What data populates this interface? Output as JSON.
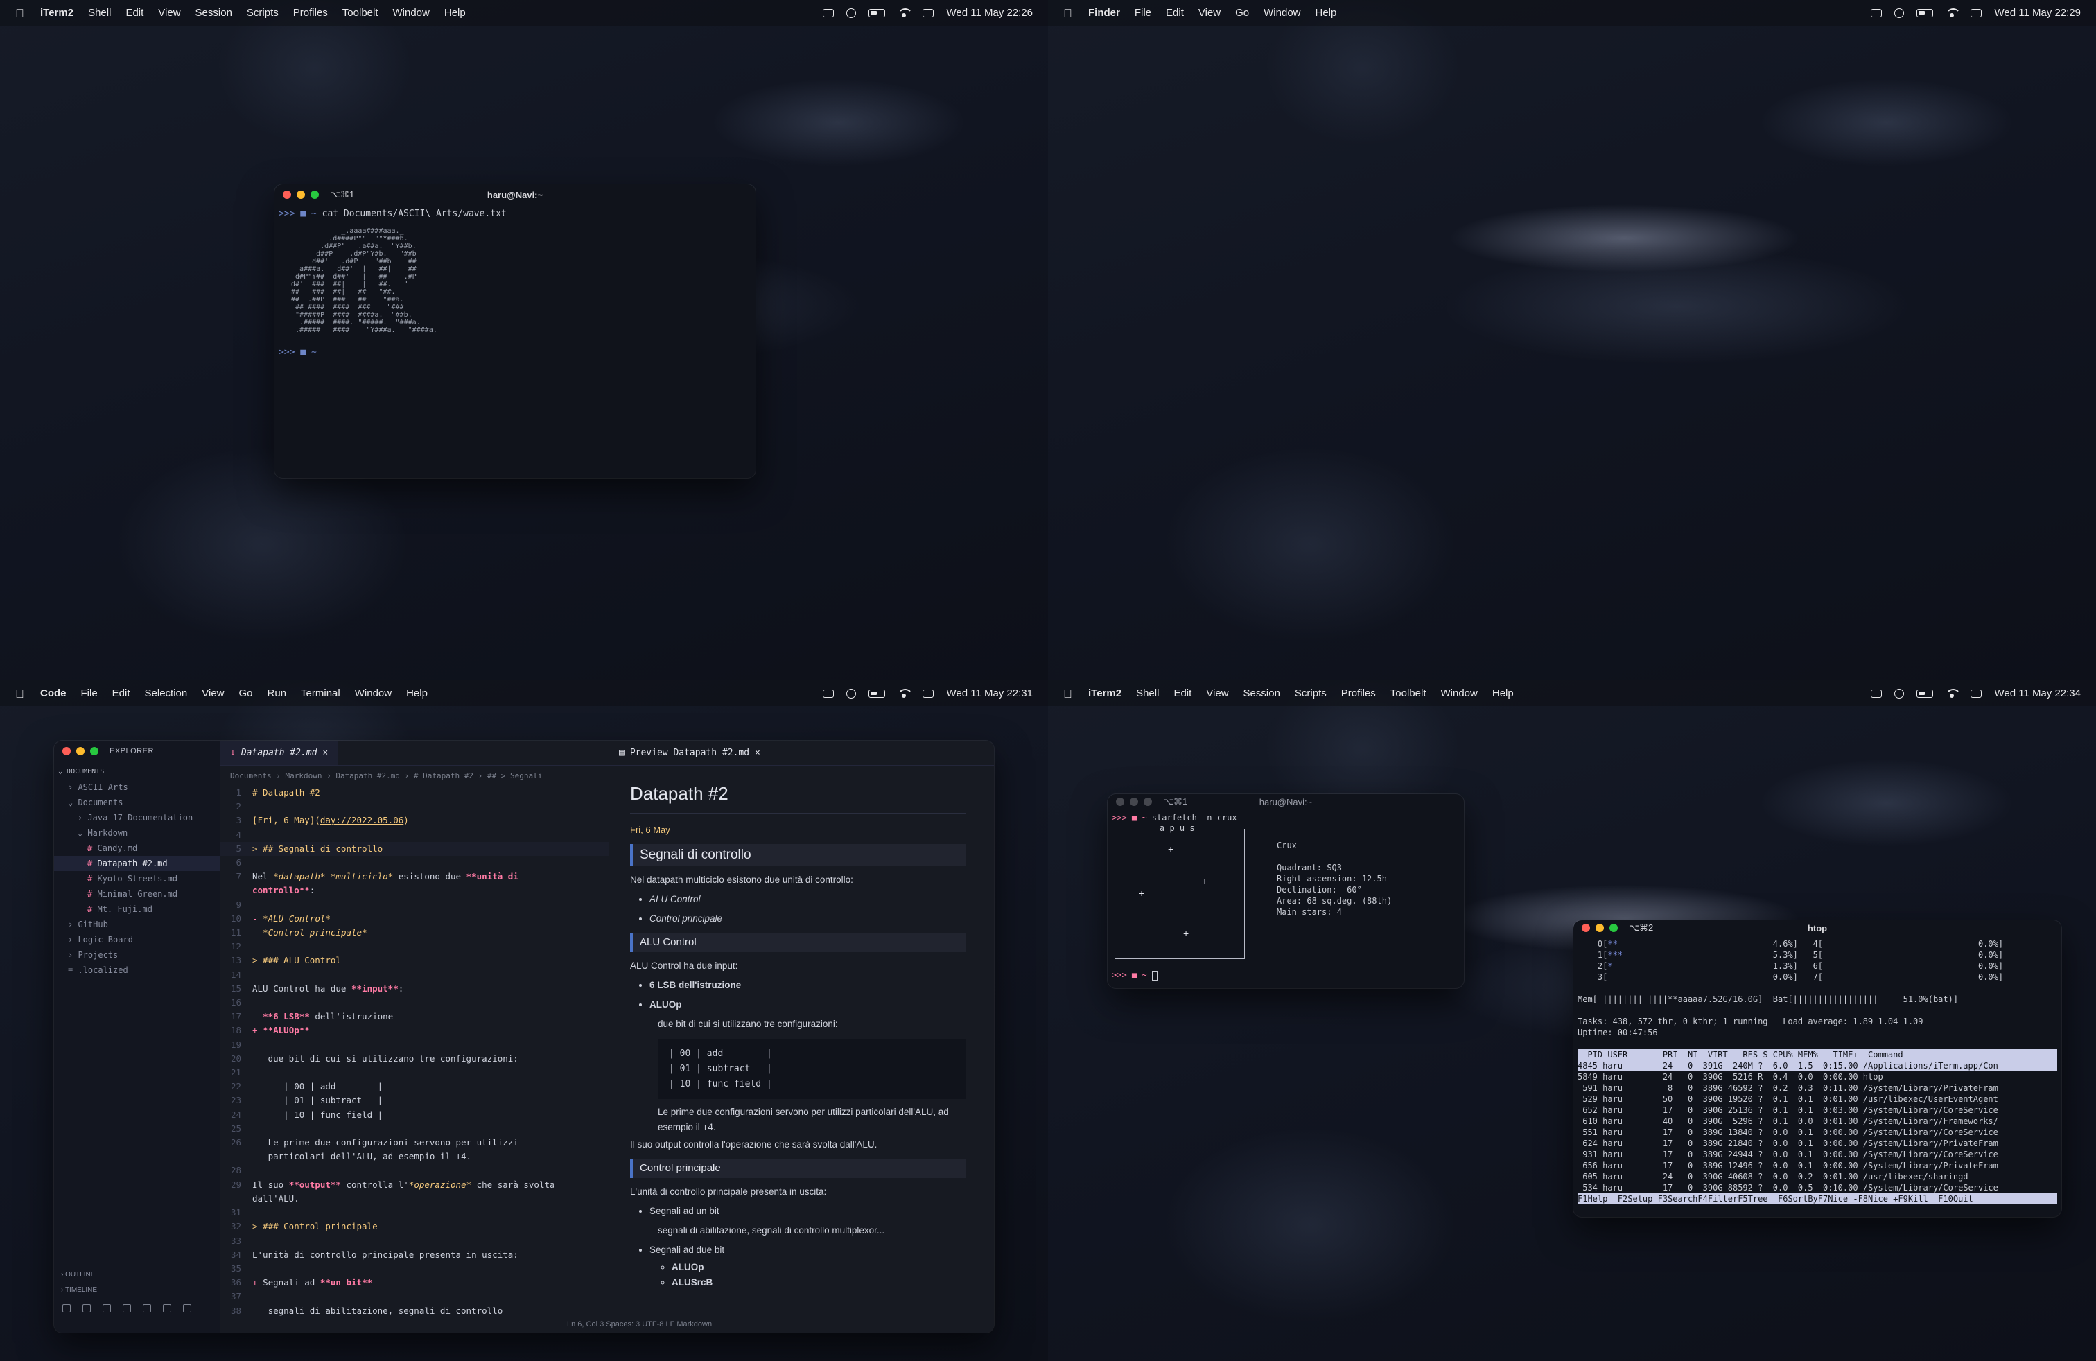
{
  "q1": {
    "menubar": {
      "app": "iTerm2",
      "items": [
        "Shell",
        "Edit",
        "View",
        "Session",
        "Scripts",
        "Profiles",
        "Toolbelt",
        "Window",
        "Help"
      ],
      "clock": "Wed 11 May  22:26"
    },
    "window": {
      "shortcut": "⌥⌘1",
      "title": "haru@Navi:~",
      "command": "cat Documents/ASCII\\ Arts/wave.txt"
    }
  },
  "q2": {
    "menubar": {
      "app": "Finder",
      "items": [
        "File",
        "Edit",
        "View",
        "Go",
        "Window",
        "Help"
      ],
      "clock": "Wed 11 May  22:29"
    }
  },
  "q3": {
    "menubar": {
      "app": "Code",
      "items": [
        "File",
        "Edit",
        "Selection",
        "View",
        "Go",
        "Run",
        "Terminal",
        "Window",
        "Help"
      ],
      "clock": "Wed 11 May  22:31"
    },
    "explorer": {
      "title": "EXPLORER",
      "tree": [
        "DOCUMENTS",
        "ASCII Arts",
        "Documents",
        "Java 17 Documentation",
        "Markdown",
        "Candy.md",
        "Datapath #2.md",
        "Kyoto Streets.md",
        "Minimal Green.md",
        "Mt. Fuji.md",
        "GitHub",
        "Logic Board",
        "Projects",
        ".localized"
      ],
      "outline": "OUTLINE",
      "timeline": "TIMELINE"
    },
    "editor": {
      "tab": "Datapath #2.md",
      "breadcrumbs": "Documents › Markdown › Datapath #2.md › # Datapath #2 › ## > Segnali",
      "status": "Ln 6, Col 3   Spaces: 3   UTF-8   LF   Markdown"
    },
    "preview": {
      "tab": "Preview Datapath #2.md",
      "h1": "Datapath #2",
      "date": "Fri, 6 May",
      "h2": "Segnali di controllo",
      "intro": "Nel datapath multiciclo esistono due unità di controllo:",
      "units": [
        "ALU Control",
        "Control principale"
      ],
      "h3a": "ALU Control",
      "alu_input": "ALU Control ha due input:",
      "inputs": [
        "6 LSB dell'istruzione",
        "ALUOp"
      ],
      "config_text": "due bit di cui si utilizzano tre configurazioni:",
      "table": "| 00 | add        |\n| 01 | subtract   |\n| 10 | func field |",
      "note": "Le prime due configurazioni servono per utilizzi particolari dell'ALU, ad esempio il +4.",
      "output": "Il suo output controlla l'operazione che sarà svolta dall'ALU.",
      "h3b": "Control principale",
      "cp_text": "L'unità di controllo principale presenta in uscita:",
      "cp_items": [
        "Segnali ad un bit",
        "Segnali ad due bit"
      ],
      "cp_sub1": "segnali di abilitazione, segnali di controllo multiplexor...",
      "cp_sub2": [
        "ALUOp",
        "ALUSrcB"
      ]
    }
  },
  "q4": {
    "menubar": {
      "app": "iTerm2",
      "items": [
        "Shell",
        "Edit",
        "View",
        "Session",
        "Scripts",
        "Profiles",
        "Toolbelt",
        "Window",
        "Help"
      ],
      "clock": "Wed 11 May  22:34"
    },
    "starfetch": {
      "shortcut": "⌥⌘1",
      "title": "haru@Navi:~",
      "command": "starfetch -n crux",
      "box_label": "a p u s",
      "name": "Crux",
      "info": [
        "Quadrant: SQ3",
        "Right ascension: 12.5h",
        "Declination: -60°",
        "Area: 68 sq.deg. (88th)",
        "Main stars: 4"
      ]
    },
    "htop": {
      "shortcut": "⌥⌘2",
      "title": "htop",
      "tasks": "Tasks: 438, 572 thr, 0 kthr; 1 running   Load average: 1.89 1.04 1.09",
      "uptime": "Uptime: 00:47:56",
      "mem": "Mem[||||||||||||||**aaaaa7.52G/16.0G]  Bat[|||||||||||||||||     51.0%(bat)]",
      "header": "  PID USER       PRI  NI  VIRT   RES S CPU% MEM%   TIME+  Command",
      "rows": [
        "4845 haru        24   0  391G  240M ?  6.0  1.5  0:15.00 /Applications/iTerm.app/Con",
        "5849 haru        24   0  390G  5216 R  0.4  0.0  0:00.00 htop",
        " 591 haru         8   0  389G 46592 ?  0.2  0.3  0:11.00 /System/Library/PrivateFram",
        " 529 haru        50   0  390G 19520 ?  0.1  0.1  0:01.00 /usr/libexec/UserEventAgent",
        " 652 haru        17   0  390G 25136 ?  0.1  0.1  0:03.00 /System/Library/CoreService",
        " 610 haru        40   0  390G  5296 ?  0.1  0.0  0:01.00 /System/Library/Frameworks/",
        " 551 haru        17   0  389G 13840 ?  0.0  0.1  0:00.00 /System/Library/CoreService",
        " 624 haru        17   0  389G 21840 ?  0.0  0.1  0:00.00 /System/Library/PrivateFram",
        " 931 haru        17   0  389G 24944 ?  0.0  0.1  0:00.00 /System/Library/CoreService",
        " 656 haru        17   0  389G 12496 ?  0.0  0.1  0:00.00 /System/Library/PrivateFram",
        " 605 haru        24   0  390G 40608 ?  0.0  0.2  0:01.00 /usr/libexec/sharingd",
        " 534 haru        17   0  390G 88592 ?  0.0  0.5  0:10.00 /System/Library/CoreService"
      ],
      "footer": "F1Help  F2Setup F3SearchF4FilterF5Tree  F6SortByF7Nice -F8Nice +F9Kill  F10Quit"
    }
  }
}
